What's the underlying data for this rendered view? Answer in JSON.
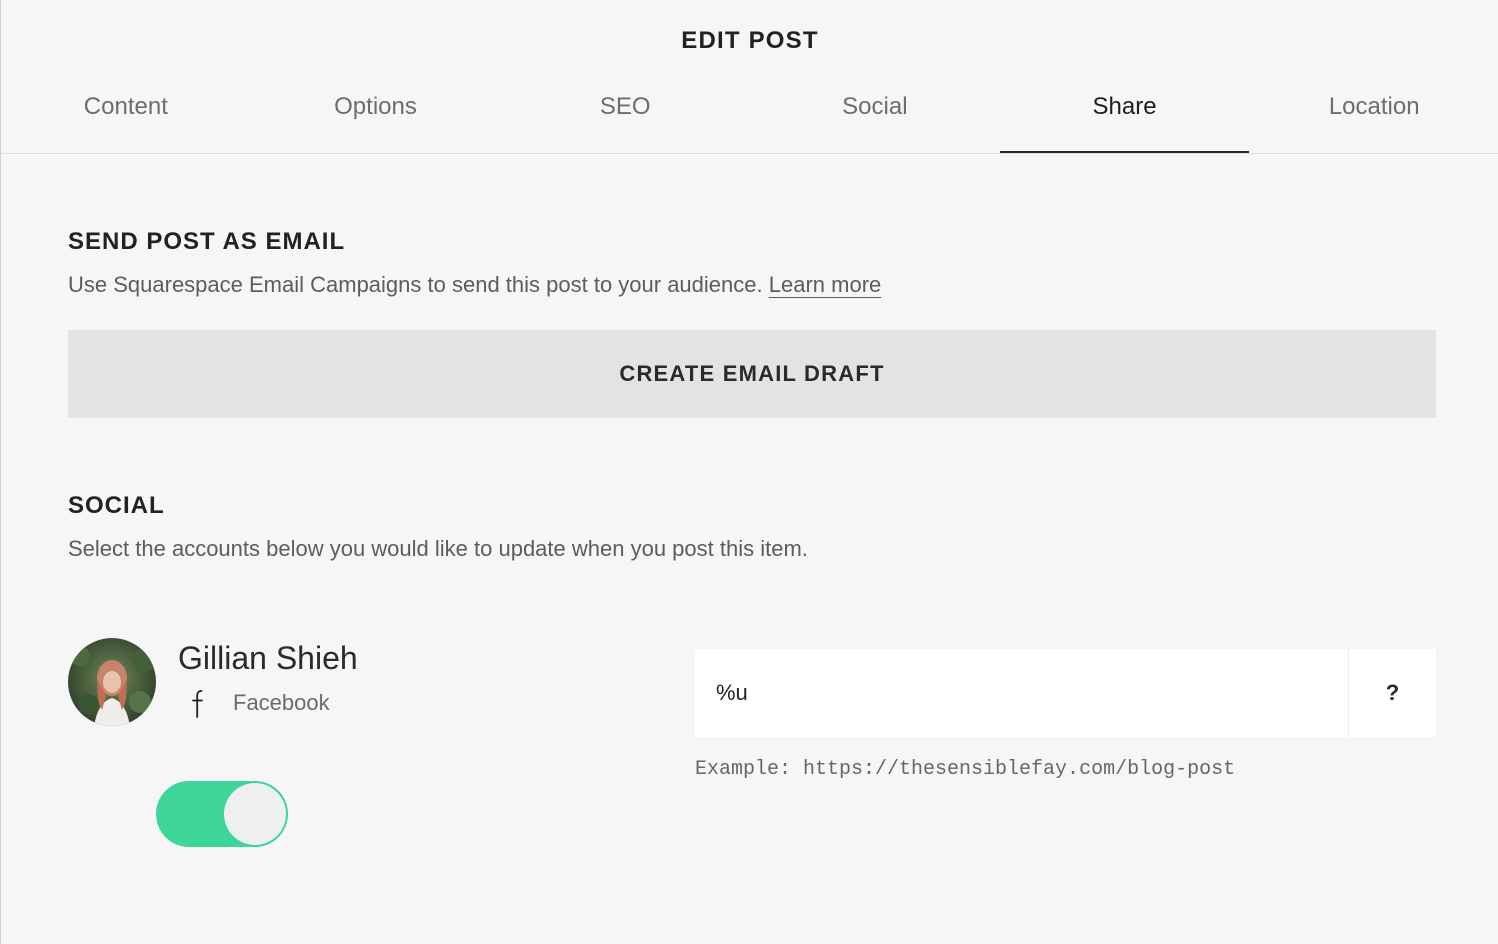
{
  "dialog": {
    "title": "EDIT POST"
  },
  "tabs": [
    {
      "label": "Content",
      "active": false
    },
    {
      "label": "Options",
      "active": false
    },
    {
      "label": "SEO",
      "active": false
    },
    {
      "label": "Social",
      "active": false
    },
    {
      "label": "Share",
      "active": true
    },
    {
      "label": "Location",
      "active": false
    }
  ],
  "email_section": {
    "heading": "SEND POST AS EMAIL",
    "description": "Use Squarespace Email Campaigns to send this post to your audience.",
    "learn_more_label": "Learn more",
    "button_label": "CREATE EMAIL DRAFT"
  },
  "social_section": {
    "heading": "SOCIAL",
    "description": "Select the accounts below you would like to update when you post this item.",
    "accounts": [
      {
        "name": "Gillian Shieh",
        "network": "Facebook",
        "network_icon": "facebook-icon",
        "enabled": true,
        "post_format": "%u",
        "help_label": "?",
        "example": "Example: https://thesensiblefay.com/blog-post"
      }
    ]
  },
  "colors": {
    "background": "#f6f6f6",
    "toggle_on": "#3dd598",
    "button_bg": "#e3e3e3",
    "active_tab_underline": "#2a2a2a"
  }
}
